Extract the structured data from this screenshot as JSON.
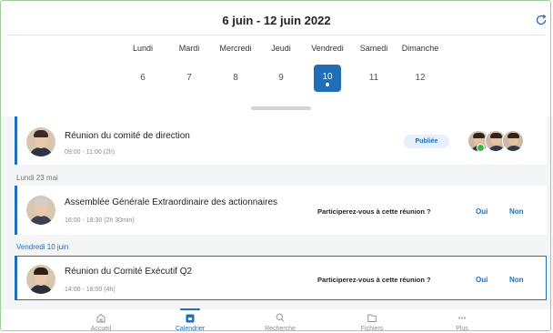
{
  "header": {
    "title": "6 juin - 12 juin 2022",
    "refresh_icon": "refresh-icon"
  },
  "week": {
    "days": [
      {
        "name": "Lundi",
        "date": "6"
      },
      {
        "name": "Mardi",
        "date": "7"
      },
      {
        "name": "Mercredi",
        "date": "8"
      },
      {
        "name": "Jeudi",
        "date": "9"
      },
      {
        "name": "Vendredi",
        "date": "10"
      },
      {
        "name": "Samedi",
        "date": "11"
      },
      {
        "name": "Dimanche",
        "date": "12"
      }
    ],
    "selected_index": 4
  },
  "meetings": {
    "first": {
      "title": "Réunion du comité de direction",
      "time": "09:00 - 11:00 (2h)",
      "badge": "Publiée"
    },
    "section_monday": "Lundi 23 mai",
    "second": {
      "title": "Assemblée Générale Extraordinaire des actionnaires",
      "time": "16:00 - 18:30 (2h 30min)",
      "question": "Participerez-vous à cette réunion ?",
      "yes": "Oui",
      "no": "Non"
    },
    "section_friday": "Vendredi 10 juin",
    "third": {
      "title": "Réunion du Comité Exécutif Q2",
      "time": "14:00 - 18:00 (4h)",
      "question": "Participerez-vous à cette réunion ?",
      "yes": "Oui",
      "no": "Non"
    }
  },
  "tabs": [
    {
      "label": "Accueil",
      "icon": "home-icon"
    },
    {
      "label": "Calendrier",
      "icon": "calendar-icon"
    },
    {
      "label": "Recherche",
      "icon": "search-icon"
    },
    {
      "label": "Fichiers",
      "icon": "folder-icon"
    },
    {
      "label": "Plus",
      "icon": "more-icon"
    }
  ],
  "colors": {
    "accent": "#1f6eb7",
    "online": "#3bb54a"
  }
}
